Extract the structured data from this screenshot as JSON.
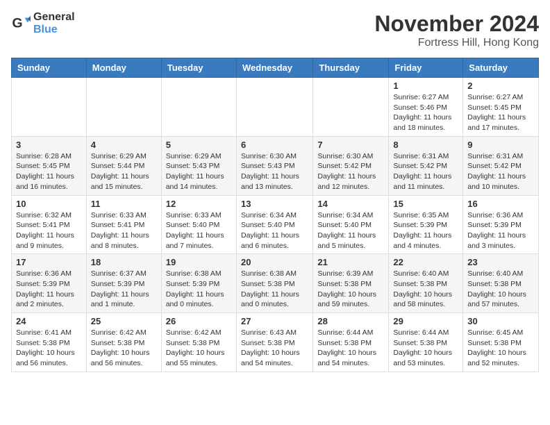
{
  "logo": {
    "general": "General",
    "blue": "Blue"
  },
  "title": "November 2024",
  "location": "Fortress Hill, Hong Kong",
  "days_of_week": [
    "Sunday",
    "Monday",
    "Tuesday",
    "Wednesday",
    "Thursday",
    "Friday",
    "Saturday"
  ],
  "weeks": [
    [
      {
        "day": "",
        "info": ""
      },
      {
        "day": "",
        "info": ""
      },
      {
        "day": "",
        "info": ""
      },
      {
        "day": "",
        "info": ""
      },
      {
        "day": "",
        "info": ""
      },
      {
        "day": "1",
        "info": "Sunrise: 6:27 AM\nSunset: 5:46 PM\nDaylight: 11 hours and 18 minutes."
      },
      {
        "day": "2",
        "info": "Sunrise: 6:27 AM\nSunset: 5:45 PM\nDaylight: 11 hours and 17 minutes."
      }
    ],
    [
      {
        "day": "3",
        "info": "Sunrise: 6:28 AM\nSunset: 5:45 PM\nDaylight: 11 hours and 16 minutes."
      },
      {
        "day": "4",
        "info": "Sunrise: 6:29 AM\nSunset: 5:44 PM\nDaylight: 11 hours and 15 minutes."
      },
      {
        "day": "5",
        "info": "Sunrise: 6:29 AM\nSunset: 5:43 PM\nDaylight: 11 hours and 14 minutes."
      },
      {
        "day": "6",
        "info": "Sunrise: 6:30 AM\nSunset: 5:43 PM\nDaylight: 11 hours and 13 minutes."
      },
      {
        "day": "7",
        "info": "Sunrise: 6:30 AM\nSunset: 5:42 PM\nDaylight: 11 hours and 12 minutes."
      },
      {
        "day": "8",
        "info": "Sunrise: 6:31 AM\nSunset: 5:42 PM\nDaylight: 11 hours and 11 minutes."
      },
      {
        "day": "9",
        "info": "Sunrise: 6:31 AM\nSunset: 5:42 PM\nDaylight: 11 hours and 10 minutes."
      }
    ],
    [
      {
        "day": "10",
        "info": "Sunrise: 6:32 AM\nSunset: 5:41 PM\nDaylight: 11 hours and 9 minutes."
      },
      {
        "day": "11",
        "info": "Sunrise: 6:33 AM\nSunset: 5:41 PM\nDaylight: 11 hours and 8 minutes."
      },
      {
        "day": "12",
        "info": "Sunrise: 6:33 AM\nSunset: 5:40 PM\nDaylight: 11 hours and 7 minutes."
      },
      {
        "day": "13",
        "info": "Sunrise: 6:34 AM\nSunset: 5:40 PM\nDaylight: 11 hours and 6 minutes."
      },
      {
        "day": "14",
        "info": "Sunrise: 6:34 AM\nSunset: 5:40 PM\nDaylight: 11 hours and 5 minutes."
      },
      {
        "day": "15",
        "info": "Sunrise: 6:35 AM\nSunset: 5:39 PM\nDaylight: 11 hours and 4 minutes."
      },
      {
        "day": "16",
        "info": "Sunrise: 6:36 AM\nSunset: 5:39 PM\nDaylight: 11 hours and 3 minutes."
      }
    ],
    [
      {
        "day": "17",
        "info": "Sunrise: 6:36 AM\nSunset: 5:39 PM\nDaylight: 11 hours and 2 minutes."
      },
      {
        "day": "18",
        "info": "Sunrise: 6:37 AM\nSunset: 5:39 PM\nDaylight: 11 hours and 1 minute."
      },
      {
        "day": "19",
        "info": "Sunrise: 6:38 AM\nSunset: 5:39 PM\nDaylight: 11 hours and 0 minutes."
      },
      {
        "day": "20",
        "info": "Sunrise: 6:38 AM\nSunset: 5:38 PM\nDaylight: 11 hours and 0 minutes."
      },
      {
        "day": "21",
        "info": "Sunrise: 6:39 AM\nSunset: 5:38 PM\nDaylight: 10 hours and 59 minutes."
      },
      {
        "day": "22",
        "info": "Sunrise: 6:40 AM\nSunset: 5:38 PM\nDaylight: 10 hours and 58 minutes."
      },
      {
        "day": "23",
        "info": "Sunrise: 6:40 AM\nSunset: 5:38 PM\nDaylight: 10 hours and 57 minutes."
      }
    ],
    [
      {
        "day": "24",
        "info": "Sunrise: 6:41 AM\nSunset: 5:38 PM\nDaylight: 10 hours and 56 minutes."
      },
      {
        "day": "25",
        "info": "Sunrise: 6:42 AM\nSunset: 5:38 PM\nDaylight: 10 hours and 56 minutes."
      },
      {
        "day": "26",
        "info": "Sunrise: 6:42 AM\nSunset: 5:38 PM\nDaylight: 10 hours and 55 minutes."
      },
      {
        "day": "27",
        "info": "Sunrise: 6:43 AM\nSunset: 5:38 PM\nDaylight: 10 hours and 54 minutes."
      },
      {
        "day": "28",
        "info": "Sunrise: 6:44 AM\nSunset: 5:38 PM\nDaylight: 10 hours and 54 minutes."
      },
      {
        "day": "29",
        "info": "Sunrise: 6:44 AM\nSunset: 5:38 PM\nDaylight: 10 hours and 53 minutes."
      },
      {
        "day": "30",
        "info": "Sunrise: 6:45 AM\nSunset: 5:38 PM\nDaylight: 10 hours and 52 minutes."
      }
    ]
  ]
}
